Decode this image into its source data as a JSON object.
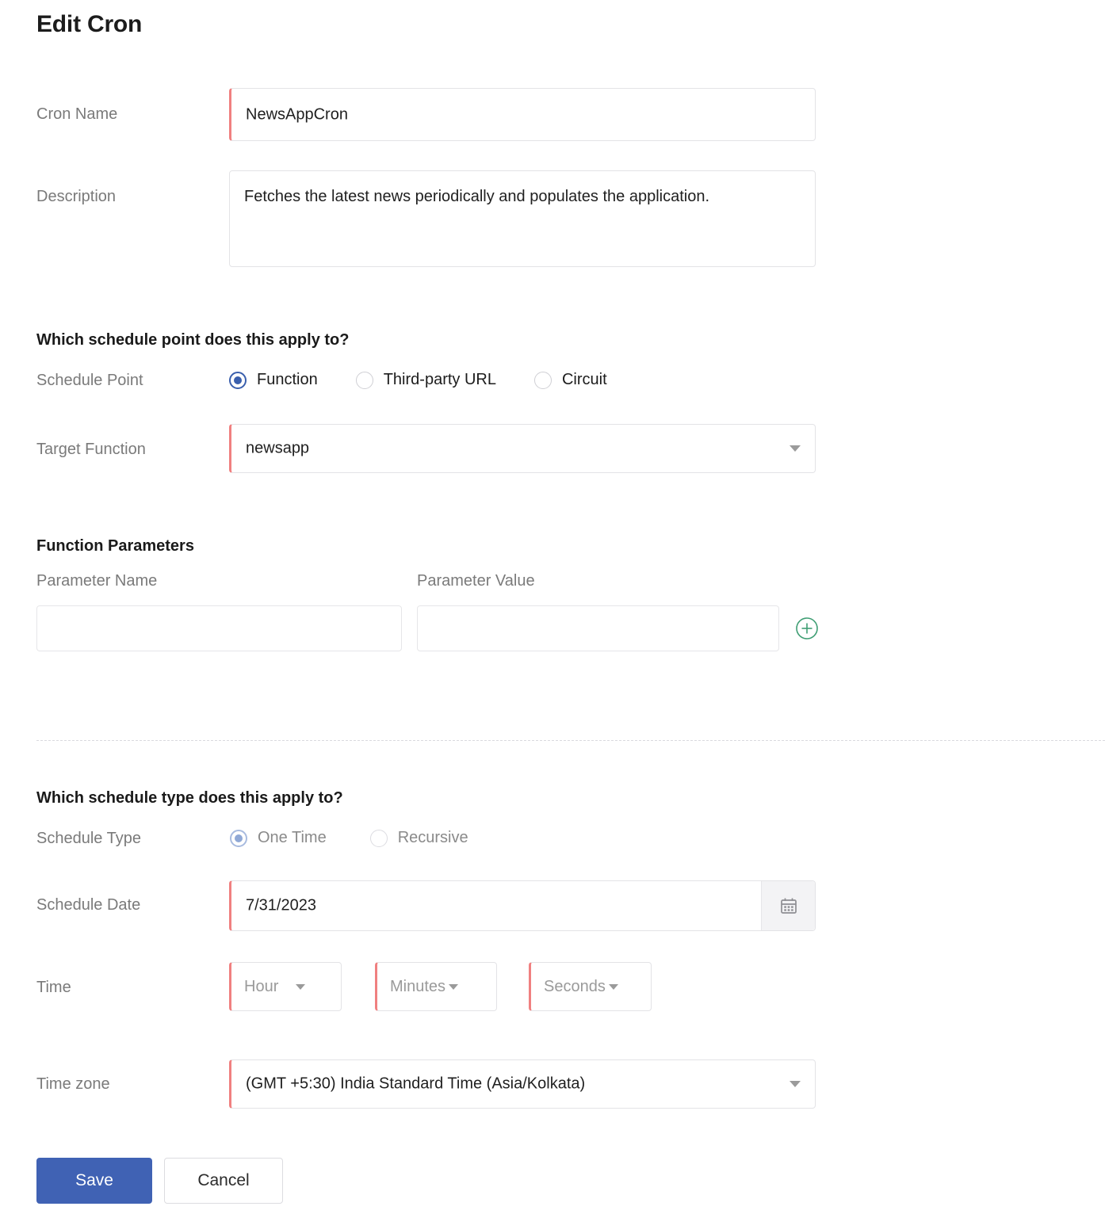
{
  "page": {
    "title": "Edit Cron"
  },
  "fields": {
    "cron_name": {
      "label": "Cron Name",
      "value": "NewsAppCron"
    },
    "description": {
      "label": "Description",
      "value": "Fetches the latest news periodically and populates the application."
    },
    "target_function": {
      "label": "Target Function",
      "value": "newsapp"
    },
    "schedule_date": {
      "label": "Schedule Date",
      "value": "7/31/2023"
    },
    "time": {
      "label": "Time"
    },
    "time_zone": {
      "label": "Time zone",
      "value": "(GMT +5:30) India Standard Time (Asia/Kolkata)"
    }
  },
  "schedule_point": {
    "heading": "Which schedule point does this apply to?",
    "label": "Schedule Point",
    "options": [
      {
        "label": "Function",
        "selected": true
      },
      {
        "label": "Third-party URL",
        "selected": false
      },
      {
        "label": "Circuit",
        "selected": false
      }
    ]
  },
  "function_parameters": {
    "heading": "Function Parameters",
    "col_name": "Parameter Name",
    "col_value": "Parameter Value",
    "rows": [
      {
        "name": "",
        "value": ""
      }
    ],
    "add_icon": "plus-circle-icon"
  },
  "schedule_type": {
    "heading": "Which schedule type does this apply to?",
    "label": "Schedule Type",
    "options": [
      {
        "label": "One Time",
        "selected": true
      },
      {
        "label": "Recursive",
        "selected": false
      }
    ]
  },
  "time_selects": [
    {
      "placeholder": "Hour"
    },
    {
      "placeholder": "Minutes"
    },
    {
      "placeholder": "Seconds"
    }
  ],
  "icons": {
    "calendar": "calendar-icon",
    "dropdown": "chevron-down-icon"
  },
  "actions": {
    "save": "Save",
    "cancel": "Cancel"
  },
  "colors": {
    "primary": "#4062b4",
    "required_marker": "#f08080",
    "add_green": "#3f9e74",
    "radio_selected": "#3a5fad"
  }
}
